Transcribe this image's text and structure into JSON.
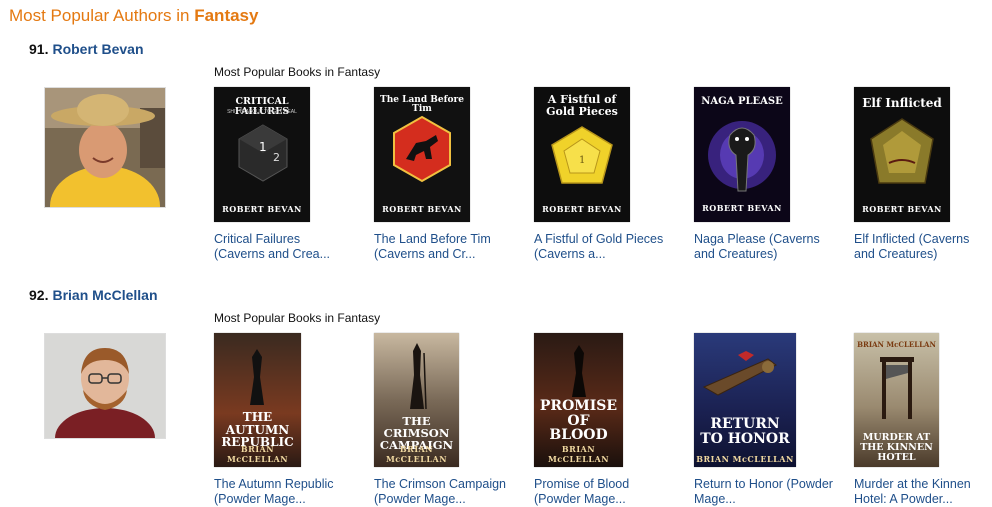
{
  "page": {
    "heading_prefix": "Most Popular Authors in ",
    "heading_genre": "Fantasy"
  },
  "authors": [
    {
      "rank": "91.",
      "name": "Robert Bevan",
      "section_label": "Most Popular Books in Fantasy",
      "books": [
        {
          "title_line1": "Critical Failures",
          "title_line2": "(Caverns and Crea...",
          "cover_title": "CRITICAL FAILURES",
          "cover_subtitle": "SHIT IS ABOUT TO GET REAL",
          "cover_author": "ROBERT BEVAN"
        },
        {
          "title_line1": "The Land Before Tim",
          "title_line2": "(Caverns and Cr...",
          "cover_title": "The Land Before Tim",
          "cover_author": "ROBERT BEVAN"
        },
        {
          "title_line1": "A Fistful of Gold Pieces",
          "title_line2": "(Caverns a...",
          "cover_title": "A Fistful of Gold Pieces",
          "cover_author": "ROBERT BEVAN"
        },
        {
          "title_line1": "Naga Please (Caverns",
          "title_line2": "and Creatures)",
          "cover_title": "NAGA PLEASE",
          "cover_author": "ROBERT BEVAN"
        },
        {
          "title_line1": "Elf Inflicted (Caverns",
          "title_line2": "and Creatures)",
          "cover_title": "Elf Inflicted",
          "cover_author": "ROBERT BEVAN"
        }
      ]
    },
    {
      "rank": "92.",
      "name": "Brian McClellan",
      "section_label": "Most Popular Books in Fantasy",
      "books": [
        {
          "title_line1": "The Autumn Republic",
          "title_line2": "(Powder Mage...",
          "cover_title": "THE AUTUMN REPUBLIC",
          "cover_author": "BRIAN McCLELLAN"
        },
        {
          "title_line1": "The Crimson Campaign",
          "title_line2": "(Powder Mage...",
          "cover_title": "THE CRIMSON CAMPAIGN",
          "cover_author": "BRIAN McCLELLAN"
        },
        {
          "title_line1": "Promise of Blood",
          "title_line2": "(Powder Mage...",
          "cover_title": "PROMISE OF BLOOD",
          "cover_author": "BRIAN McCLELLAN"
        },
        {
          "title_line1": "Return to Honor (Powder",
          "title_line2": "Mage...",
          "cover_title": "RETURN TO HONOR",
          "cover_author": "BRIAN McCLELLAN"
        },
        {
          "title_line1": "Murder at the Kinnen",
          "title_line2": "Hotel: A Powder...",
          "cover_title": "MURDER AT THE KINNEN HOTEL",
          "cover_author": "BRIAN McCLELLAN"
        }
      ]
    }
  ],
  "colors": {
    "heading": "#e47911",
    "link": "#1f4f8a"
  }
}
